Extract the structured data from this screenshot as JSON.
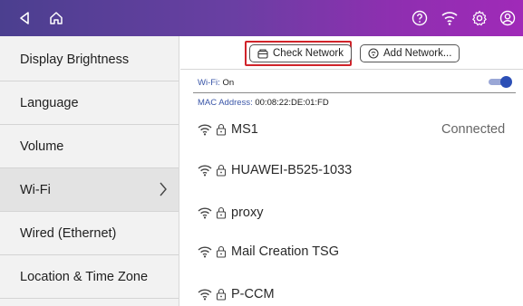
{
  "topbar": {
    "icons": [
      "back-icon",
      "home-icon",
      "help-icon",
      "wifi-status-icon",
      "settings-icon",
      "account-icon"
    ]
  },
  "sidebar": {
    "items": [
      {
        "label": "Display Brightness"
      },
      {
        "label": "Language"
      },
      {
        "label": "Volume"
      },
      {
        "label": "Wi-Fi",
        "active": true
      },
      {
        "label": "Wired (Ethernet)"
      },
      {
        "label": "Location & Time Zone"
      }
    ]
  },
  "toolbar": {
    "check_network": "Check Network",
    "add_network": "Add Network..."
  },
  "wifi": {
    "label": "Wi-Fi:",
    "value": "On",
    "enabled": true,
    "mac_label": "MAC Address:",
    "mac_value": "00:08:22:DE:01:FD"
  },
  "networks": [
    {
      "name": "MS1",
      "secured": true,
      "status": "Connected"
    },
    {
      "name": "HUAWEI-B525-1033",
      "secured": true,
      "status": ""
    },
    {
      "name": "proxy",
      "secured": true,
      "status": ""
    },
    {
      "name": "Mail Creation TSG",
      "secured": true,
      "status": ""
    },
    {
      "name": "P-CCM",
      "secured": true,
      "status": ""
    }
  ],
  "colors": {
    "topbar_start": "#4b3f8f",
    "topbar_end": "#a02ab8",
    "highlight": "#d0232a",
    "toggle_on": "#2c4fb6",
    "label_blue": "#3a56a8"
  }
}
